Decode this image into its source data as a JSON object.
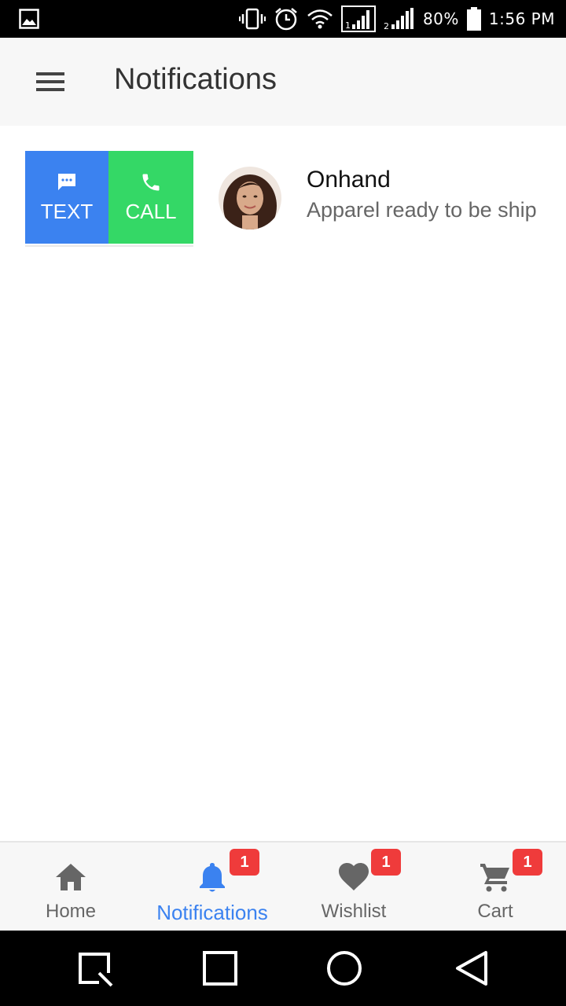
{
  "status_bar": {
    "battery": "80%",
    "time": "1:56 PM",
    "icons": [
      "gallery-icon",
      "vibrate-icon",
      "alarm-icon",
      "wifi-icon",
      "signal-sim1-icon",
      "signal-sim2-icon",
      "battery-icon"
    ]
  },
  "app_bar": {
    "title": "Notifications",
    "menu_icon": "hamburger-menu-icon"
  },
  "notification": {
    "actions": [
      {
        "label": "TEXT",
        "icon": "message-icon",
        "color": "#3b82f0"
      },
      {
        "label": "CALL",
        "icon": "phone-icon",
        "color": "#34d866"
      }
    ],
    "title": "Onhand",
    "subtitle": "Apparel ready to be ship",
    "avatar": "profile-photo"
  },
  "bottom_nav": {
    "items": [
      {
        "label": "Home",
        "icon": "home-icon",
        "badge": null,
        "active": false
      },
      {
        "label": "Notifications",
        "icon": "bell-icon",
        "badge": "1",
        "active": true
      },
      {
        "label": "Wishlist",
        "icon": "heart-icon",
        "badge": "1",
        "active": false
      },
      {
        "label": "Cart",
        "icon": "cart-icon",
        "badge": "1",
        "active": false
      }
    ],
    "active_color": "#3b82f0",
    "badge_color": "#ef3b3b"
  },
  "system_nav": {
    "icons": [
      "recents-icon",
      "home-square-icon",
      "home-circle-icon",
      "back-icon"
    ]
  }
}
